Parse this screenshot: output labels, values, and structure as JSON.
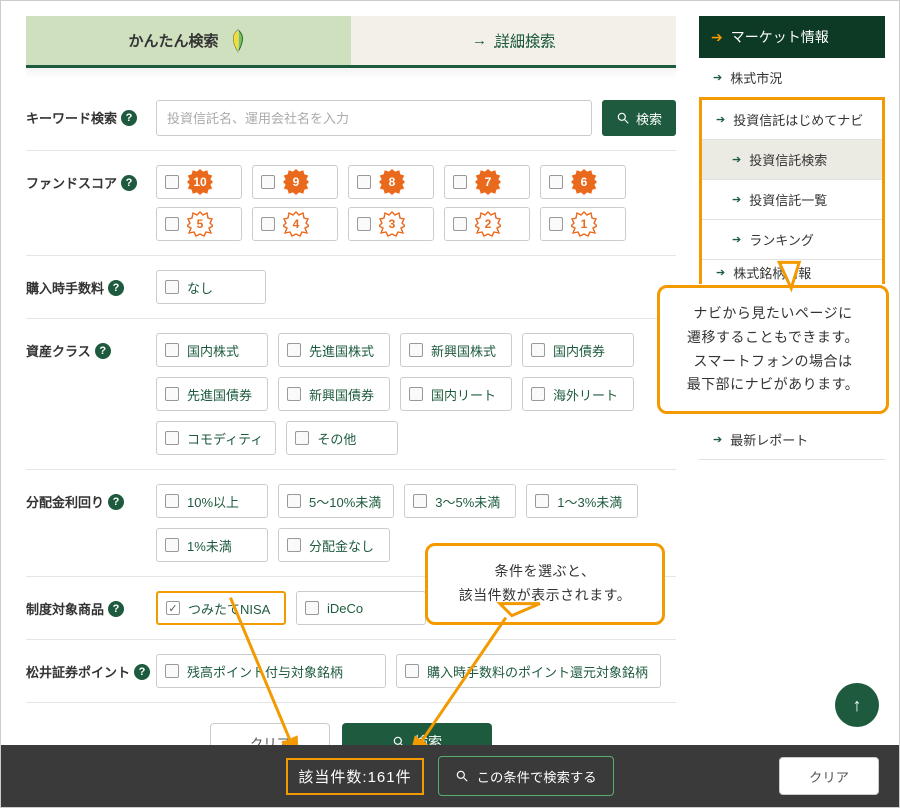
{
  "tabs": {
    "simple": "かんたん検索",
    "detail": "詳細検索"
  },
  "search": {
    "keyword_label": "キーワード検索",
    "placeholder": "投資信託名、運用会社名を入力",
    "button": "検索"
  },
  "rows": {
    "fundscore": {
      "label": "ファンドスコア",
      "top": [
        "10",
        "9",
        "8",
        "7",
        "6"
      ],
      "bottom": [
        "5",
        "4",
        "3",
        "2",
        "1"
      ]
    },
    "fee": {
      "label": "購入時手数料",
      "options": [
        "なし"
      ]
    },
    "asset": {
      "label": "資産クラス",
      "options": [
        "国内株式",
        "先進国株式",
        "新興国株式",
        "国内債券",
        "先進国債券",
        "新興国債券",
        "国内リート",
        "海外リート",
        "コモディティ",
        "その他"
      ]
    },
    "dividend": {
      "label": "分配金利回り",
      "options": [
        "10%以上",
        "5〜10%未満",
        "3〜5%未満",
        "1〜3%未満",
        "1%未満",
        "分配金なし"
      ]
    },
    "program": {
      "label": "制度対象商品",
      "options": [
        "つみたてNISA",
        "iDeCo"
      ]
    },
    "points": {
      "label": "松井証券ポイント",
      "options": [
        "残高ポイント付与対象銘柄",
        "購入時手数料のポイント還元対象銘柄"
      ]
    }
  },
  "actions": {
    "clear": "クリア",
    "search": "検索"
  },
  "sticky": {
    "count_label": "該当件数:",
    "count_value": "161件",
    "search": "この条件で検索する",
    "clear": "クリア"
  },
  "sidebar": {
    "header": "マーケット情報",
    "items": [
      "株式市況",
      "投資信託はじめてナビ"
    ],
    "subitems": [
      "投資信託検索",
      "投資信託一覧",
      "ランキング"
    ],
    "items_after": [
      "株式銘柄情報"
    ],
    "last": "最新レポート"
  },
  "callouts": {
    "nav": "ナビから見たいページに\n遷移することもできます。\nスマートフォンの場合は\n最下部にナビがあります。",
    "condition": "条件を選ぶと、\n該当件数が表示されます。"
  }
}
